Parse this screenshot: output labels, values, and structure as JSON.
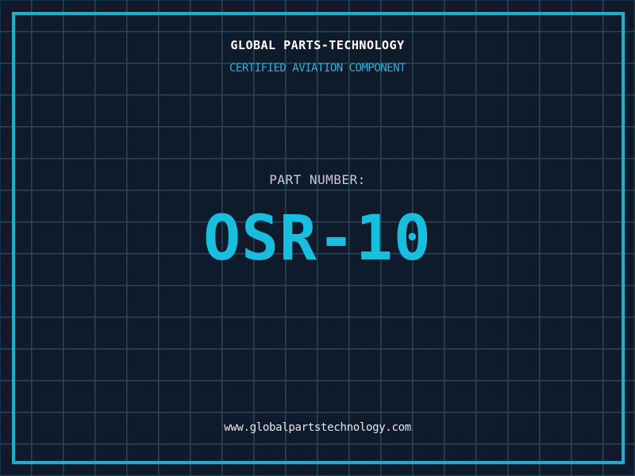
{
  "meta": {
    "colors": {
      "background": "#0f1a2b",
      "grid_line": "#1b4a61",
      "frame_border": "#12b2d6",
      "company_name_text": "#ffffff",
      "tagline_text": "#2fb0d4",
      "part_label_text": "#c5ccd6",
      "part_number_text": "#18bede",
      "website_text": "#e2e7ec"
    },
    "grid_cell_size_px": 40
  },
  "header": {
    "company_name": "GLOBAL PARTS-TECHNOLOGY",
    "tagline": "CERTIFIED AVIATION COMPONENT"
  },
  "part": {
    "label": "PART NUMBER:",
    "number": "OSR-10"
  },
  "footer": {
    "website": "www.globalpartstechnology.com"
  }
}
